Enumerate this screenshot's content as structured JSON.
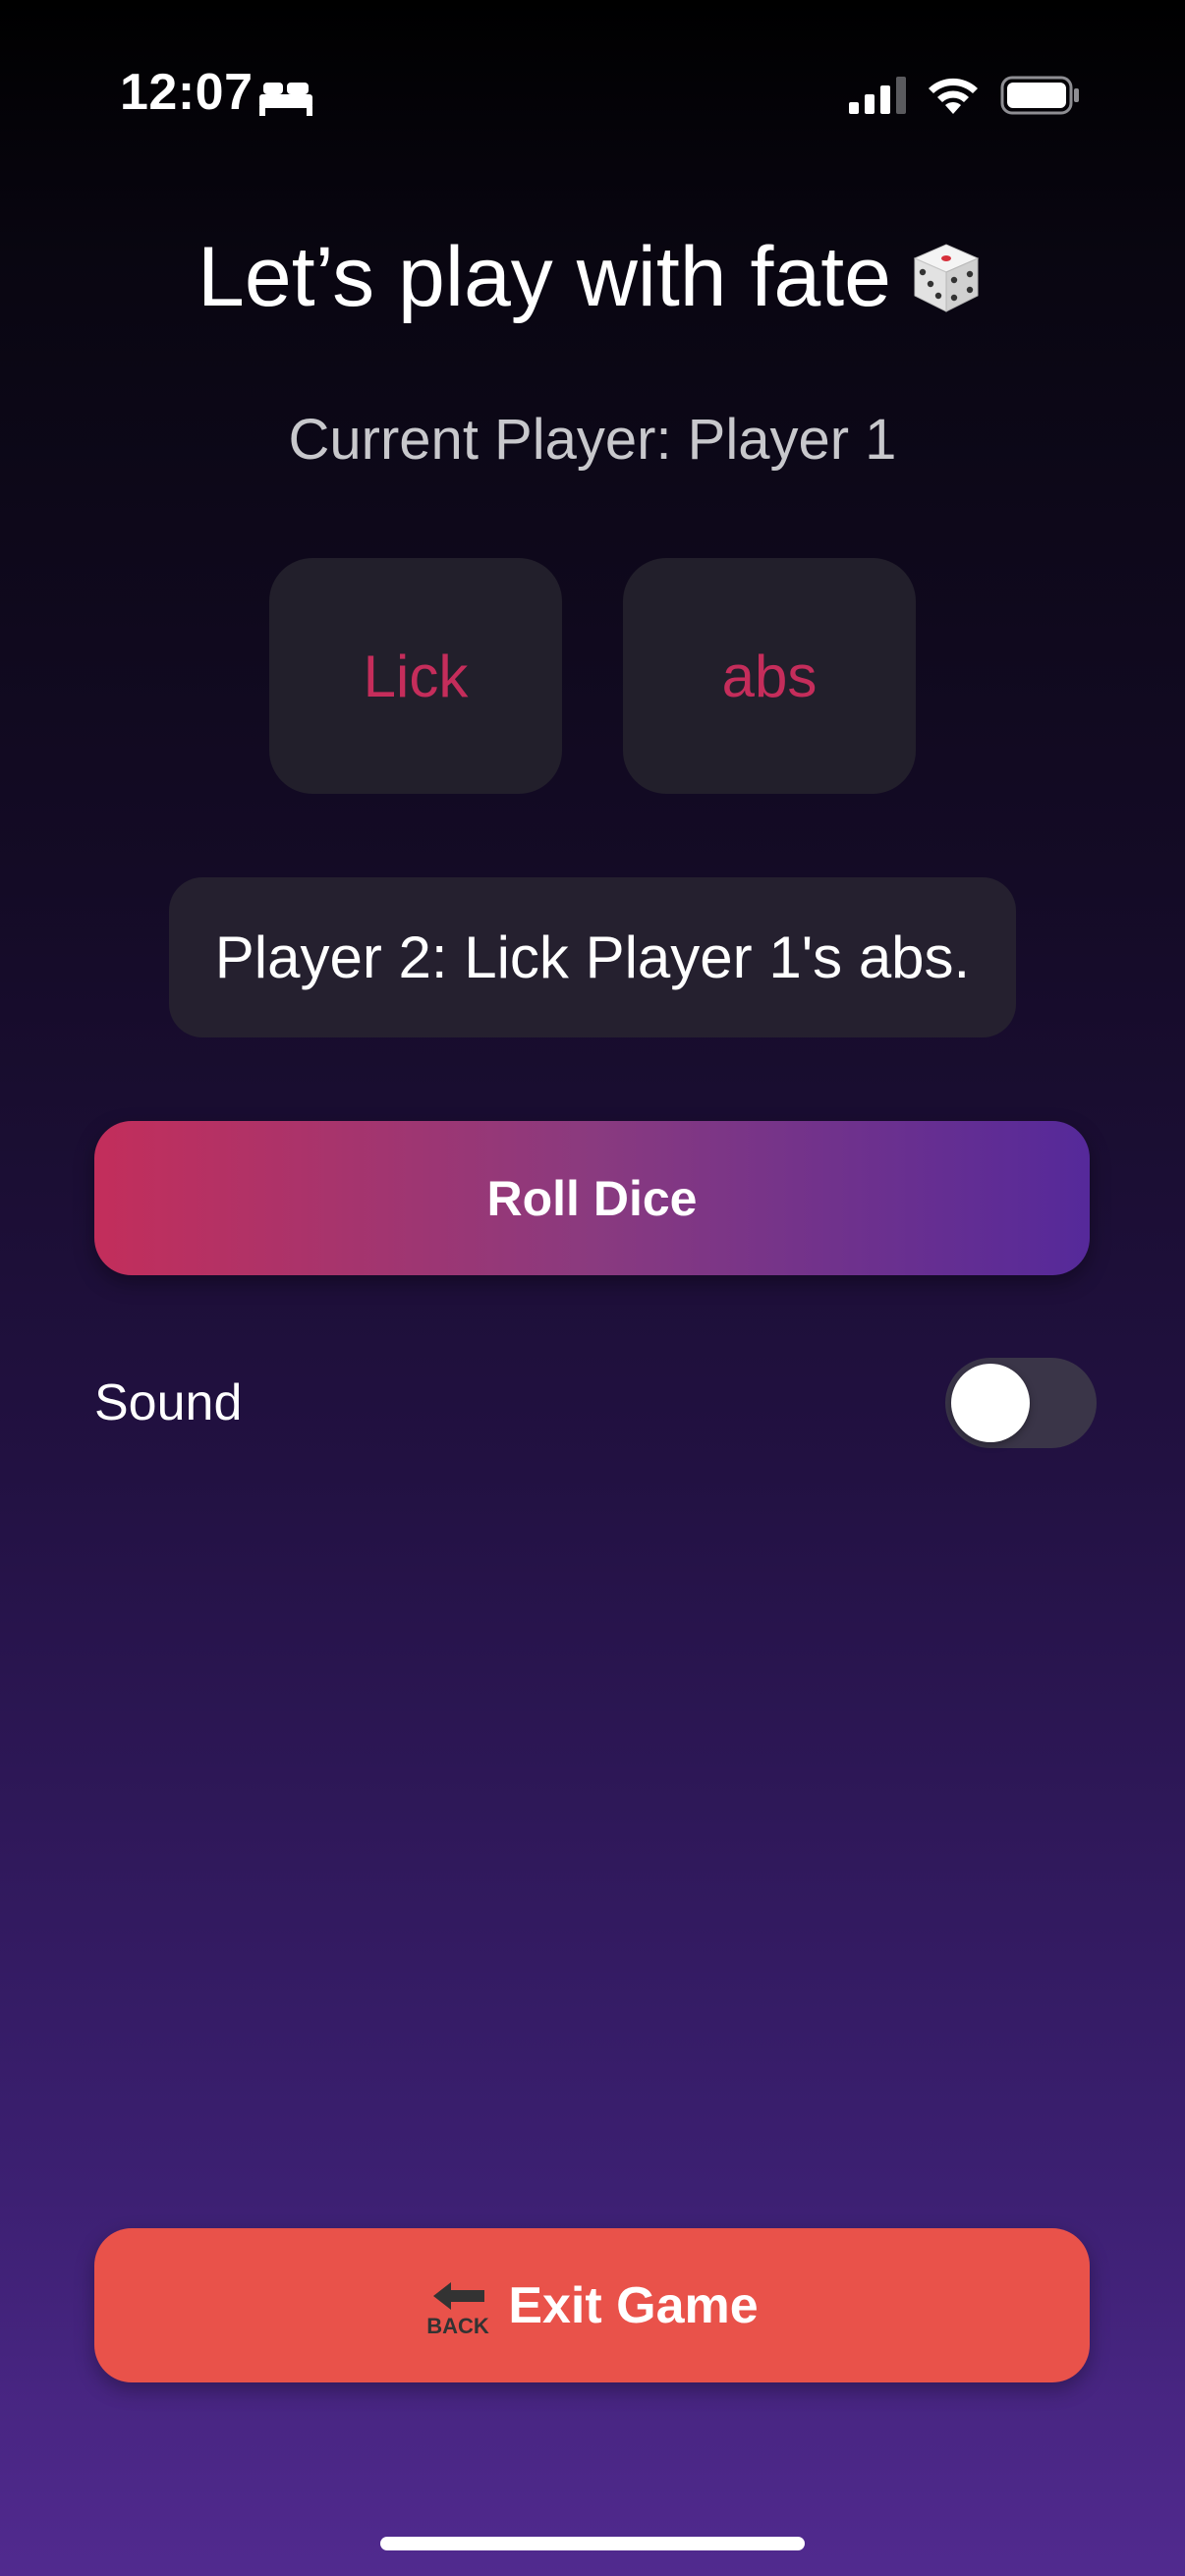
{
  "status_bar": {
    "time": "12:07",
    "icons": [
      "bed-icon",
      "signal-icon",
      "wifi-icon",
      "battery-icon"
    ]
  },
  "title": "Let’s play with fate",
  "title_icon": "dice-icon",
  "current_player": "Current Player: Player 1",
  "dice": {
    "left": "Lick",
    "right": "abs"
  },
  "result": "Player 2: Lick Player 1's abs.",
  "roll_button": "Roll Dice",
  "sound": {
    "label": "Sound",
    "enabled": false
  },
  "exit_button": {
    "label": "Exit Game",
    "icon": "back-arrow-icon",
    "icon_text": "BACK"
  },
  "colors": {
    "accent_pink": "#c52d5b",
    "accent_purple": "#55299a",
    "exit_red": "#e9524a",
    "card_bg": "#221f2b"
  }
}
